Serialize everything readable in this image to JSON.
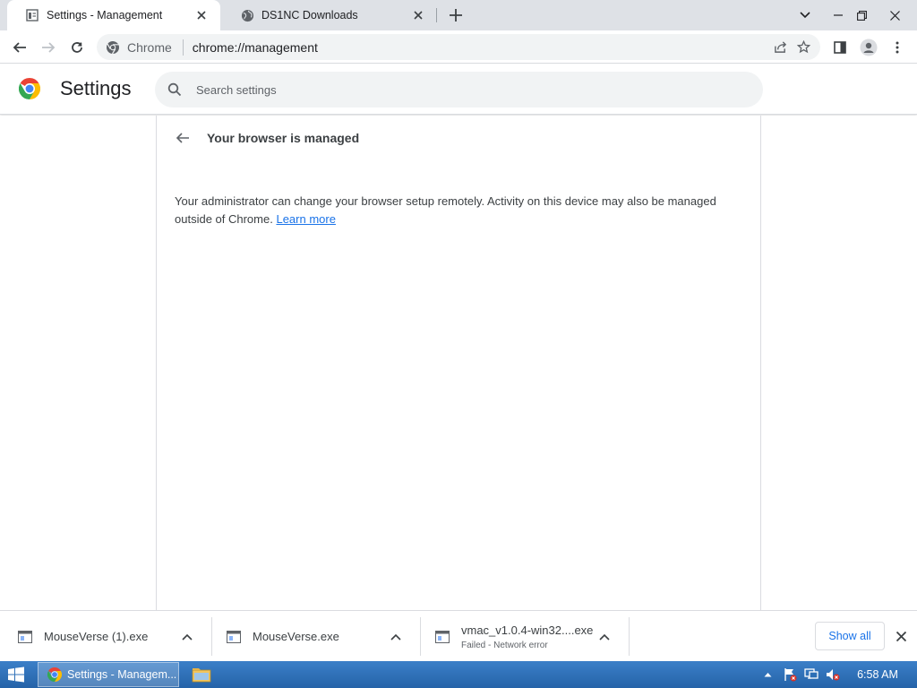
{
  "browser": {
    "tabs": [
      {
        "title": "Settings - Management",
        "active": true
      },
      {
        "title": "DS1NC Downloads",
        "active": false
      }
    ],
    "toolbar": {
      "site_chip": "Chrome",
      "url": "chrome://management"
    }
  },
  "settings": {
    "title": "Settings",
    "search_placeholder": "Search settings"
  },
  "management": {
    "page_title": "Your browser is managed",
    "description": "Your administrator can change your browser setup remotely. Activity on this device may also be managed outside of Chrome.",
    "learn_more": "Learn more"
  },
  "downloads": {
    "items": [
      {
        "name": "MouseVerse (1).exe",
        "status": ""
      },
      {
        "name": "MouseVerse.exe",
        "status": ""
      },
      {
        "name": "vmac_v1.0.4-win32....exe",
        "status": "Failed - Network error"
      }
    ],
    "show_all": "Show all"
  },
  "taskbar": {
    "active_app": "Settings - Managem...",
    "clock": "6:58 AM"
  },
  "colors": {
    "tabstrip_bg": "#dee1e6",
    "accent_blue": "#1a73e8",
    "taskbar_blue": "#2d6fb6",
    "chrome_red": "#ea4335",
    "chrome_yellow": "#fbbc04",
    "chrome_green": "#34a853",
    "chrome_blue": "#4285f4"
  },
  "icons": [
    "settings-page-icon",
    "globe-icon",
    "close-icon",
    "plus-icon",
    "chevron-down-icon",
    "minimize-icon",
    "restore-icon",
    "back-arrow-icon",
    "forward-arrow-icon",
    "reload-icon",
    "chrome-icon",
    "share-icon",
    "star-icon",
    "side-panel-icon",
    "profile-icon",
    "more-icon",
    "search-icon",
    "file-icon",
    "chevron-up-icon",
    "windows-start-icon",
    "folder-icon",
    "flag-icon",
    "network-icon",
    "volume-muted-icon"
  ]
}
